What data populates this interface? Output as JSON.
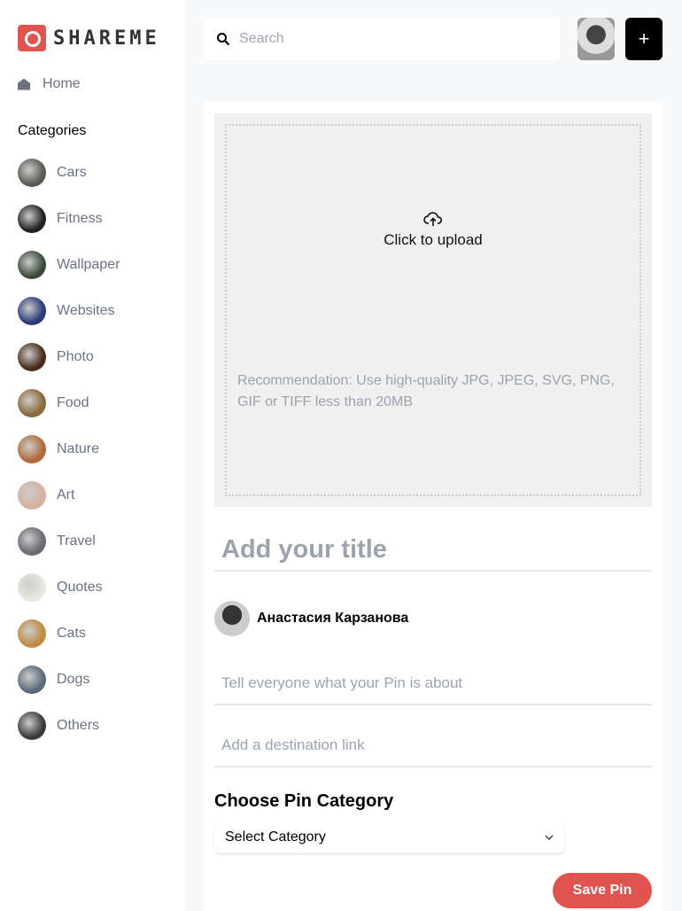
{
  "brand": {
    "name": "SHAREME",
    "accent": "#e0534e"
  },
  "sidebar": {
    "home": "Home",
    "categories_title": "Categories",
    "categories": [
      {
        "label": "Cars",
        "color": "#5a5a55"
      },
      {
        "label": "Fitness",
        "color": "#222"
      },
      {
        "label": "Wallpaper",
        "color": "#3b4a3a"
      },
      {
        "label": "Websites",
        "color": "#2a3a7a"
      },
      {
        "label": "Photo",
        "color": "#4a2a1a"
      },
      {
        "label": "Food",
        "color": "#8a6a3a"
      },
      {
        "label": "Nature",
        "color": "#b06a3a"
      },
      {
        "label": "Art",
        "color": "#d8b0a0"
      },
      {
        "label": "Travel",
        "color": "#6a6a70"
      },
      {
        "label": "Quotes",
        "color": "#e8e8e0"
      },
      {
        "label": "Cats",
        "color": "#c08a40"
      },
      {
        "label": "Dogs",
        "color": "#5a6a7a"
      },
      {
        "label": "Others",
        "color": "#3a3a3a"
      }
    ]
  },
  "header": {
    "search_placeholder": "Search",
    "add_label": "+"
  },
  "form": {
    "upload_label": "Click to upload",
    "recommendation": "Recommendation: Use high-quality JPG, JPEG, SVG, PNG, GIF or TIFF less than 20MB",
    "title_placeholder": "Add your title",
    "user_name": "Анастасия Карзанова",
    "about_placeholder": "Tell everyone what your Pin is about",
    "link_placeholder": "Add a destination link",
    "category_heading": "Choose Pin Category",
    "category_selected": "Select Category",
    "save_label": "Save Pin"
  }
}
